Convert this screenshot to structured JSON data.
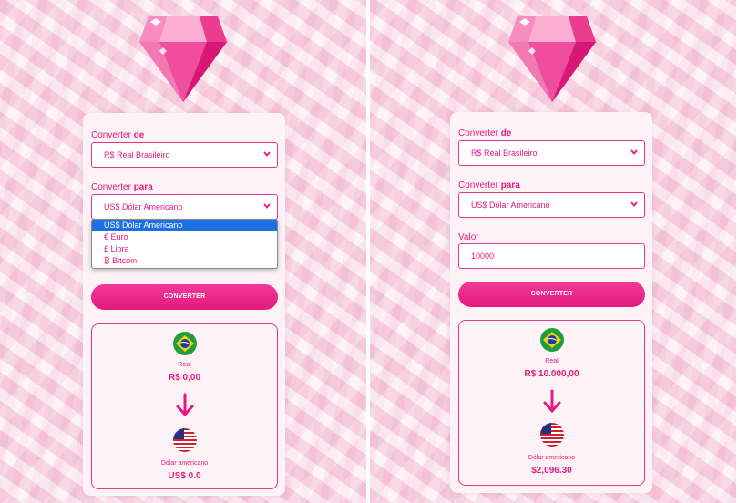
{
  "colors": {
    "accent": "#e6197f",
    "card": "#fdf3f6",
    "selected_option": "#1e6fe0"
  },
  "left": {
    "from_label": {
      "prefix": "Converter ",
      "bold": "de"
    },
    "from_value": "R$ Real Brasileiro",
    "to_label": {
      "prefix": "Converter ",
      "bold": "para"
    },
    "to_value": "US$ Dólar Americano",
    "dropdown_options": [
      "US$ Dólar Americano",
      "€ Euro",
      "£ Libra",
      "₿ Bitcoin"
    ],
    "button": "CONVERTER",
    "result": {
      "from_icon": "brazil-flag-icon",
      "from_name": "Real",
      "from_amount": "R$ 0,00",
      "arrow_icon": "arrow-down-icon",
      "to_icon": "usa-flag-icon",
      "to_name": "Dólar americano",
      "to_amount": "US$ 0.0"
    }
  },
  "right": {
    "from_label": {
      "prefix": "Converter ",
      "bold": "de"
    },
    "from_value": "R$ Real Brasileiro",
    "to_label": {
      "prefix": "Converter ",
      "bold": "para"
    },
    "to_value": "US$ Dólar Americano",
    "value_label": "Valor",
    "value_input": "10000",
    "button": "CONVERTER",
    "result": {
      "from_icon": "brazil-flag-icon",
      "from_name": "Real",
      "from_amount": "R$ 10.000,00",
      "arrow_icon": "arrow-down-icon",
      "to_icon": "usa-flag-icon",
      "to_name": "Dólar americano",
      "to_amount": "$2,096.30"
    }
  }
}
